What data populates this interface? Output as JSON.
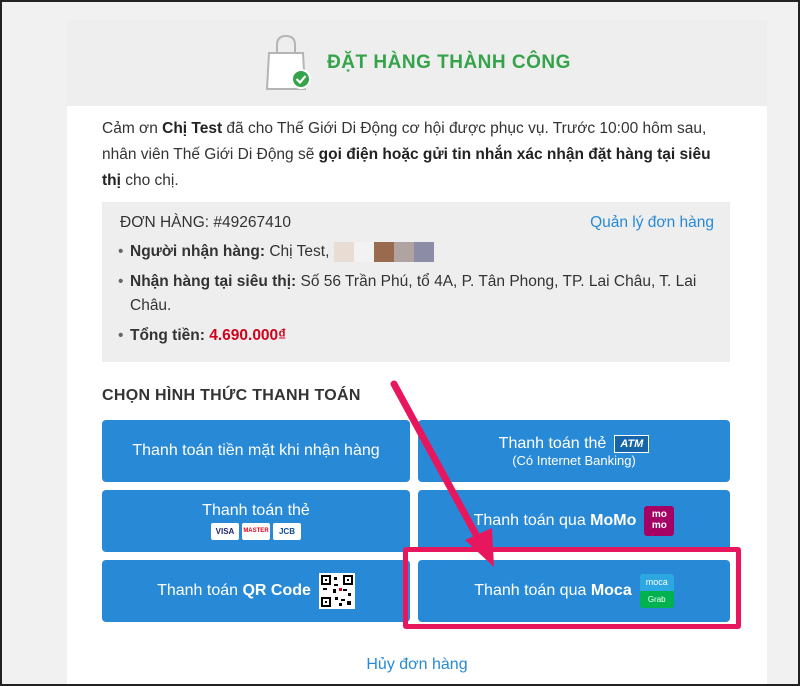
{
  "header": {
    "title": "ĐẶT HÀNG THÀNH CÔNG",
    "icon": "shopping-bag-check-icon",
    "accent_color": "#35a34a"
  },
  "intro": {
    "part1": "Cảm ơn ",
    "customer": "Chị Test",
    "part2": " đã cho Thế Giới Di Động cơ hội được phục vụ. Trước 10:00 hôm sau, nhân viên Thế Giới Di Động sẽ ",
    "emphasis": "gọi điện hoặc gửi tin nhắn xác nhận đặt hàng tại siêu thị",
    "part3": " cho chị."
  },
  "order": {
    "code": "ĐƠN HÀNG: #49267410",
    "manage_link": "Quản lý đơn hàng",
    "recipient_label": "Người nhận hàng:",
    "recipient_value": " Chị Test,",
    "pickup_label": "Nhận hàng tại siêu thị:",
    "pickup_value": " Số 56 Trần Phú, tổ 4A, P. Tân Phong, TP. Lai Châu, T. Lai Châu.",
    "total_label": "Tổng tiền:",
    "total_value": "4.690.000₫",
    "total_color": "#d0021b"
  },
  "payment": {
    "title": "CHỌN HÌNH THỨC THANH TOÁN",
    "cash": "Thanh toán tiền mặt khi nhận hàng",
    "atm_label": "Thanh toán thẻ",
    "atm_badge": "ATM",
    "atm_sub": "(Có Internet Banking)",
    "card_label": "Thanh toán thẻ",
    "card_logos": [
      "VISA",
      "MASTER",
      "JCB"
    ],
    "momo_prefix": "Thanh toán qua ",
    "momo_name": "MoMo",
    "momo_logo": "mo mo",
    "qr_prefix": "Thanh toán ",
    "qr_name": "QR Code",
    "moca_prefix": "Thanh toán qua ",
    "moca_name": "Moca",
    "moca_logo_top": "moca",
    "moca_logo_bottom": "Grab",
    "button_color": "#288ad6"
  },
  "cancel_link": "Hủy đơn hàng",
  "annotation": {
    "highlight_color": "#e8175d"
  }
}
